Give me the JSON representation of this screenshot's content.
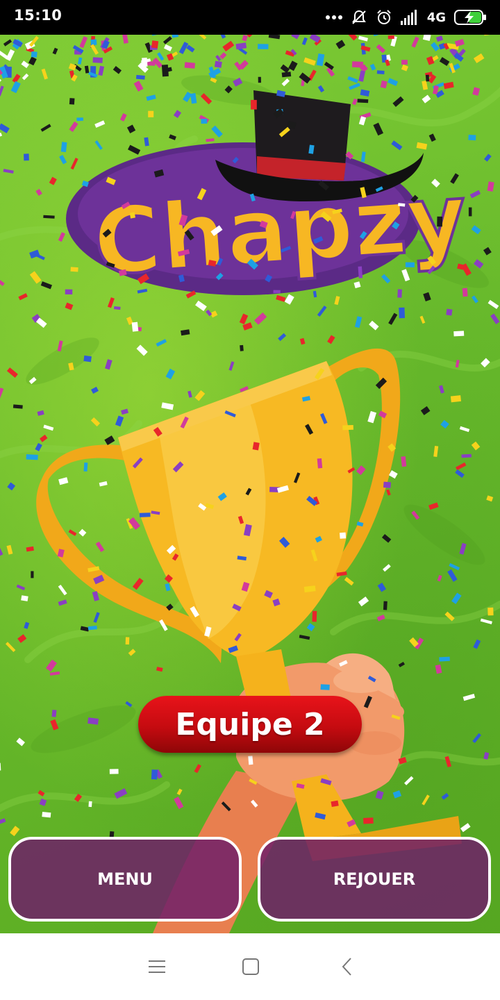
{
  "status_bar": {
    "time": "15:10",
    "network": "4G",
    "icons": [
      "more-dots-icon",
      "notifications-off-icon",
      "alarm-icon",
      "signal-icon",
      "battery-charging-icon"
    ]
  },
  "game": {
    "logo_text": "Chapzy",
    "winner_label": "Equipe 2",
    "buttons": {
      "menu": "MENU",
      "replay": "REJOUER"
    }
  },
  "colors": {
    "background_green": "#6abd2d",
    "badge_red": "#d80d13",
    "button_purple": "#6e1e69",
    "trophy_gold": "#f5b21c"
  },
  "nav_bar": {
    "icons": [
      "menu-lines-icon",
      "home-square-icon",
      "back-chevron-icon"
    ]
  }
}
